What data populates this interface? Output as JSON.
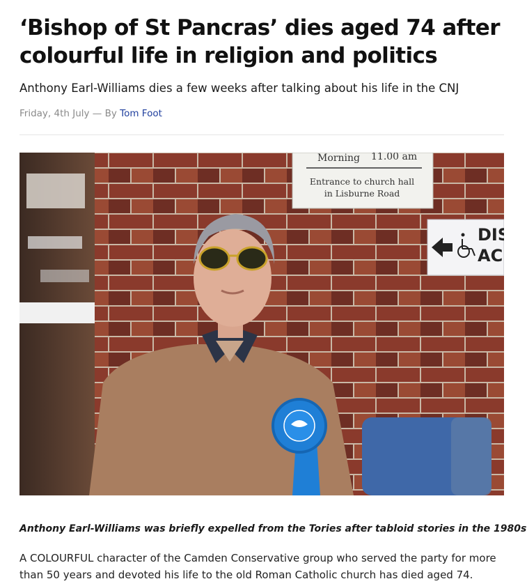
{
  "article": {
    "headline": "‘Bishop of St Pancras’ dies aged 74 after colourful life in religion and politics",
    "standfirst": "Anthony Earl-Williams dies a few weeks after talking about his life in the CNJ",
    "date": "Friday, 4th July",
    "byline_separator": " — By ",
    "author": "Tom Foot",
    "caption": "Anthony Earl-Williams was briefly expelled from the Tories after tabloid stories in the 1980s",
    "body_first_paragraph": "A COLOURFUL character of the Camden Conservative group who served the party for more than 50 years and devoted his life to the old Roman Catholic church has died aged 74."
  },
  "photo": {
    "sign_top_line_1": "Morning",
    "sign_top_line_2": "11.00 am",
    "sign_entrance_line_1": "Entrance to church hall",
    "sign_entrance_line_2": "in Lisburne Road",
    "sign_access_line_1": "DIS",
    "sign_access_line_2": "AC"
  },
  "colors": {
    "headline": "#111111",
    "author_link": "#1f3f9e",
    "byline_muted": "#8a8a8a",
    "rosette_blue": "#1f7fd6"
  }
}
